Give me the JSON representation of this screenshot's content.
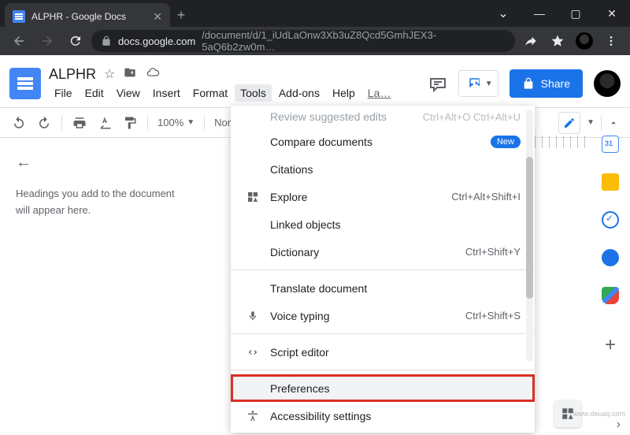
{
  "browser": {
    "tab_title": "ALPHR - Google Docs",
    "url_host": "docs.google.com",
    "url_path": "/document/d/1_iUdLaOnw3Xb3uZ8Qcd5GmhJEX3-5aQ6b2zw0m…"
  },
  "doc": {
    "title": "ALPHR"
  },
  "menubar": {
    "file": "File",
    "edit": "Edit",
    "view": "View",
    "insert": "Insert",
    "format": "Format",
    "tools": "Tools",
    "addons": "Add-ons",
    "help": "Help",
    "last": "La…"
  },
  "toolbar": {
    "zoom": "100%",
    "style": "Normal…"
  },
  "share": {
    "label": "Share"
  },
  "outline": {
    "hint": "Headings you add to the document will appear here."
  },
  "tools_menu": {
    "review": "Review suggested edits",
    "review_shortcut": "Ctrl+Alt+O Ctrl+Alt+U",
    "compare": "Compare documents",
    "new_badge": "New",
    "citations": "Citations",
    "explore": "Explore",
    "explore_shortcut": "Ctrl+Alt+Shift+I",
    "linked": "Linked objects",
    "dictionary": "Dictionary",
    "dictionary_shortcut": "Ctrl+Shift+Y",
    "translate": "Translate document",
    "voice": "Voice typing",
    "voice_shortcut": "Ctrl+Shift+S",
    "script": "Script editor",
    "preferences": "Preferences",
    "accessibility": "Accessibility settings"
  },
  "watermark": "www.deuaq.com"
}
